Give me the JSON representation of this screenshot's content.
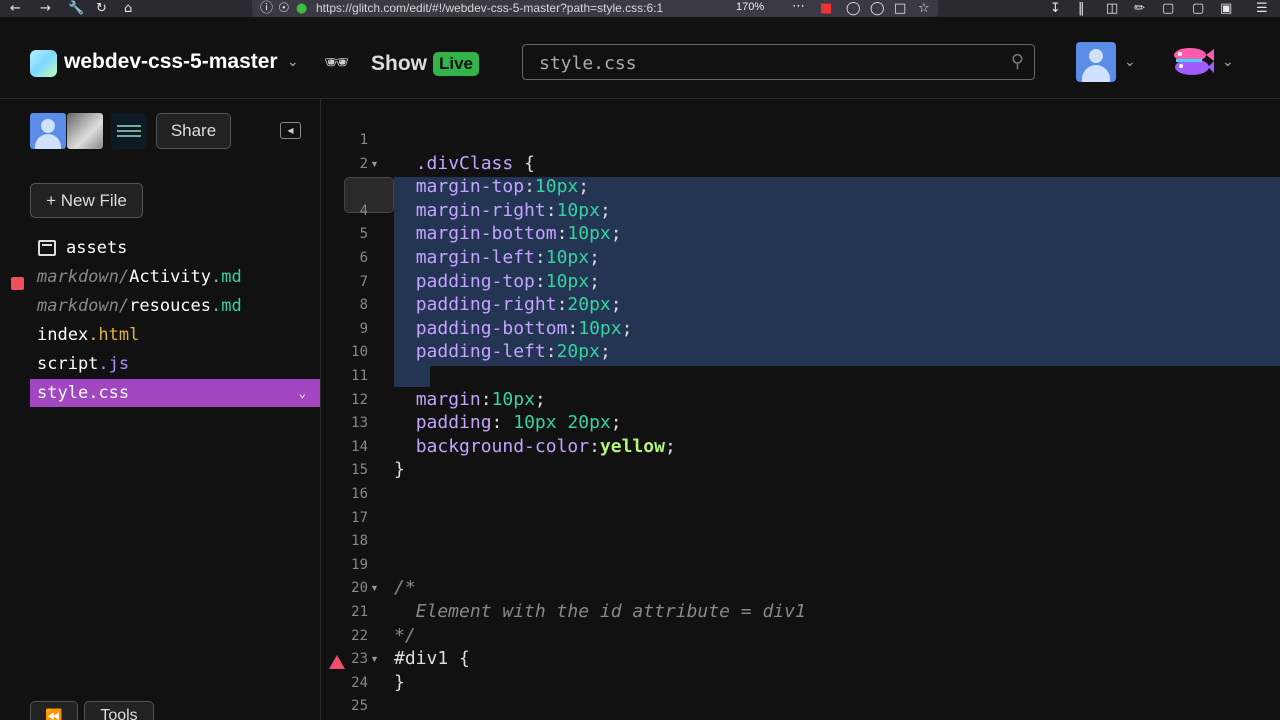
{
  "browser": {
    "url": "https://glitch.com/edit/#!/webdev-css-5-master?path=style.css:6:1",
    "zoom": "170%"
  },
  "header": {
    "project_name": "webdev-css-5-master",
    "show_label": "Show",
    "live_badge": "Live",
    "search_placeholder": "style.css"
  },
  "sidebar": {
    "share_label": "Share",
    "new_file_label": "+ New File",
    "tools_label": "Tools",
    "files": [
      {
        "dir": "",
        "base": "assets",
        "ext": "",
        "type": "folder"
      },
      {
        "dir": "markdown/",
        "base": "Activity",
        "ext": ".md",
        "type": "md"
      },
      {
        "dir": "markdown/",
        "base": "resouces",
        "ext": ".md",
        "type": "md"
      },
      {
        "dir": "",
        "base": "index",
        "ext": ".html",
        "type": "html"
      },
      {
        "dir": "",
        "base": "script",
        "ext": ".js",
        "type": "js"
      },
      {
        "dir": "",
        "base": "style",
        "ext": ".css",
        "type": "css",
        "selected": true
      }
    ]
  },
  "editor": {
    "lines": [
      {
        "n": "1",
        "parts": []
      },
      {
        "n": "2",
        "fold": true,
        "indent": "  ",
        "parts": [
          {
            "t": ".divClass",
            "c": "c-sel"
          },
          {
            "t": " {",
            "c": "c-punc"
          }
        ]
      },
      {
        "n": "",
        "indent": "  ",
        "parts": [
          {
            "t": "margin-top",
            "c": "c-prop"
          },
          {
            "t": ":",
            "c": "c-punc"
          },
          {
            "t": "10px",
            "c": "c-val"
          },
          {
            "t": ";",
            "c": "c-punc"
          }
        ]
      },
      {
        "n": "4",
        "indent": "  ",
        "parts": [
          {
            "t": "margin-right",
            "c": "c-prop"
          },
          {
            "t": ":",
            "c": "c-punc"
          },
          {
            "t": "10px",
            "c": "c-val"
          },
          {
            "t": ";",
            "c": "c-punc"
          }
        ]
      },
      {
        "n": "5",
        "indent": "  ",
        "parts": [
          {
            "t": "margin-bottom",
            "c": "c-prop"
          },
          {
            "t": ":",
            "c": "c-punc"
          },
          {
            "t": "10px",
            "c": "c-val"
          },
          {
            "t": ";",
            "c": "c-punc"
          }
        ]
      },
      {
        "n": "6",
        "indent": "  ",
        "parts": [
          {
            "t": "margin-left",
            "c": "c-prop"
          },
          {
            "t": ":",
            "c": "c-punc"
          },
          {
            "t": "10px",
            "c": "c-val"
          },
          {
            "t": ";",
            "c": "c-punc"
          }
        ]
      },
      {
        "n": "7",
        "indent": "  ",
        "parts": [
          {
            "t": "padding-top",
            "c": "c-prop"
          },
          {
            "t": ":",
            "c": "c-punc"
          },
          {
            "t": "10px",
            "c": "c-val"
          },
          {
            "t": ";",
            "c": "c-punc"
          }
        ]
      },
      {
        "n": "8",
        "indent": "  ",
        "parts": [
          {
            "t": "padding-right",
            "c": "c-prop"
          },
          {
            "t": ":",
            "c": "c-punc"
          },
          {
            "t": "20px",
            "c": "c-val"
          },
          {
            "t": ";",
            "c": "c-punc"
          }
        ]
      },
      {
        "n": "9",
        "indent": "  ",
        "parts": [
          {
            "t": "padding-bottom",
            "c": "c-prop"
          },
          {
            "t": ":",
            "c": "c-punc"
          },
          {
            "t": "10px",
            "c": "c-val"
          },
          {
            "t": ";",
            "c": "c-punc"
          }
        ]
      },
      {
        "n": "10",
        "indent": "  ",
        "parts": [
          {
            "t": "padding-left",
            "c": "c-prop"
          },
          {
            "t": ":",
            "c": "c-punc"
          },
          {
            "t": "20px",
            "c": "c-val"
          },
          {
            "t": ";",
            "c": "c-punc"
          }
        ]
      },
      {
        "n": "11",
        "parts": []
      },
      {
        "n": "12",
        "indent": "  ",
        "parts": [
          {
            "t": "margin",
            "c": "c-prop"
          },
          {
            "t": ":",
            "c": "c-punc"
          },
          {
            "t": "10px",
            "c": "c-val"
          },
          {
            "t": ";",
            "c": "c-punc"
          }
        ]
      },
      {
        "n": "13",
        "indent": "  ",
        "parts": [
          {
            "t": "padding",
            "c": "c-prop"
          },
          {
            "t": ": ",
            "c": "c-punc"
          },
          {
            "t": "10px 20px",
            "c": "c-val"
          },
          {
            "t": ";",
            "c": "c-punc"
          }
        ]
      },
      {
        "n": "14",
        "indent": "  ",
        "parts": [
          {
            "t": "background-color",
            "c": "c-prop"
          },
          {
            "t": ":",
            "c": "c-punc"
          },
          {
            "t": "yellow",
            "c": "c-kw"
          },
          {
            "t": ";",
            "c": "c-punc"
          }
        ]
      },
      {
        "n": "15",
        "parts": [
          {
            "t": "}",
            "c": "c-punc"
          }
        ]
      },
      {
        "n": "16",
        "parts": []
      },
      {
        "n": "17",
        "parts": []
      },
      {
        "n": "18",
        "parts": []
      },
      {
        "n": "19",
        "parts": []
      },
      {
        "n": "20",
        "fold": true,
        "parts": [
          {
            "t": "/*",
            "c": "c-comment"
          }
        ]
      },
      {
        "n": "21",
        "parts": [
          {
            "t": "  Element with the id attribute = div1",
            "c": "c-comment"
          }
        ]
      },
      {
        "n": "22",
        "parts": [
          {
            "t": "*/",
            "c": "c-comment"
          }
        ]
      },
      {
        "n": "23",
        "fold": true,
        "warn": true,
        "parts": [
          {
            "t": "#div1",
            "c": "c-plain"
          },
          {
            "t": " {",
            "c": "c-punc"
          }
        ]
      },
      {
        "n": "24",
        "parts": [
          {
            "t": "}",
            "c": "c-punc"
          }
        ]
      },
      {
        "n": "25",
        "parts": []
      }
    ]
  },
  "colors": {
    "selected_file": "#a246c2",
    "live_badge": "#32b34a",
    "selection": "#243554"
  }
}
